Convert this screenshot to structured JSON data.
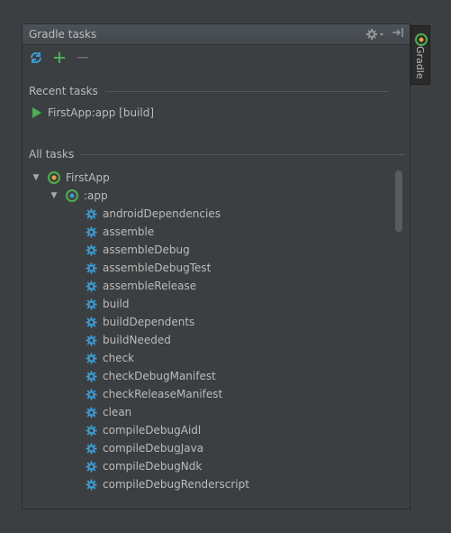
{
  "panel": {
    "title": "Gradle tasks",
    "side_tab_label": "Gradle"
  },
  "toolbar": {
    "icons": [
      "refresh-icon",
      "add-icon",
      "remove-icon"
    ]
  },
  "recent": {
    "header": "Recent tasks",
    "items": [
      "FirstApp:app [build]"
    ]
  },
  "all": {
    "header": "All tasks",
    "root": "FirstApp",
    "module": ":app",
    "tasks": [
      "androidDependencies",
      "assemble",
      "assembleDebug",
      "assembleDebugTest",
      "assembleRelease",
      "build",
      "buildDependents",
      "buildNeeded",
      "check",
      "checkDebugManifest",
      "checkReleaseManifest",
      "clean",
      "compileDebugAidl",
      "compileDebugJava",
      "compileDebugNdk",
      "compileDebugRenderscript"
    ]
  },
  "colors": {
    "background": "#3c3f41",
    "text": "#bbbbbb",
    "accent_green": "#4caf50",
    "task_blue": "#3d9ad1"
  }
}
